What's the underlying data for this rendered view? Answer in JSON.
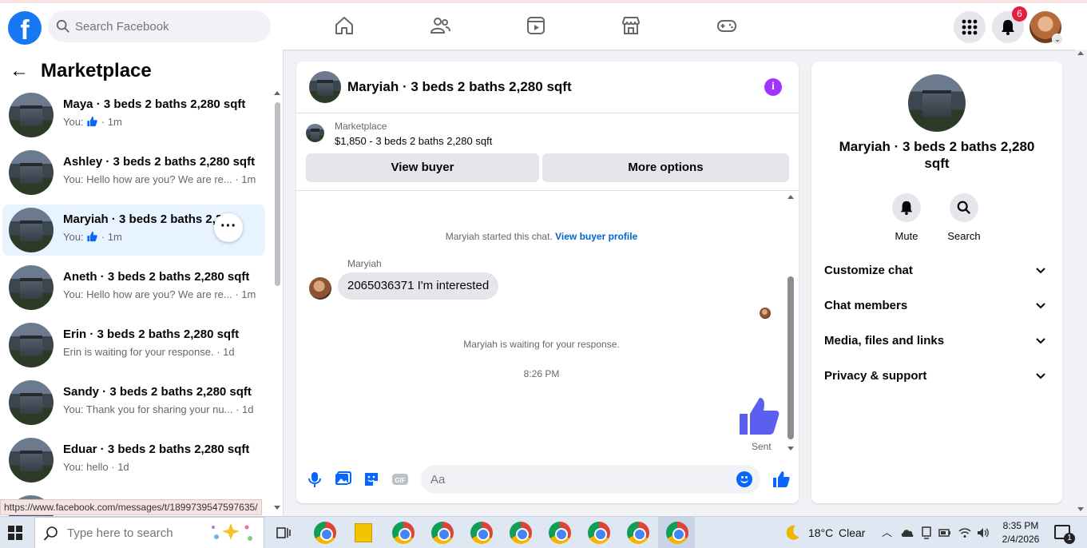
{
  "header": {
    "logo_letter": "f",
    "search_placeholder": "Search Facebook",
    "nav_icons": [
      "home-icon",
      "friends-icon",
      "watch-icon",
      "marketplace-icon",
      "gaming-icon"
    ],
    "notification_count": "6",
    "brand_color": "#1877f2"
  },
  "left_panel": {
    "title": "Marketplace",
    "conversations": [
      {
        "title": "Maya · 3 beds 2 baths 2,280 sqft",
        "prefix": "You:",
        "time": "· 1m",
        "has_like": true
      },
      {
        "title": "Ashley · 3 beds 2 baths 2,280 sqft",
        "snippet": "You: Hello how are you? We are re...",
        "time": "· 1m"
      },
      {
        "title": "Maryiah · 3 beds 2 baths 2,28...",
        "prefix": "You:",
        "time": "· 1m",
        "has_like": true,
        "active": true
      },
      {
        "title": "Aneth · 3 beds 2 baths 2,280 sqft",
        "snippet": "You: Hello how are you? We are re...",
        "time": "· 1m"
      },
      {
        "title": "Erin · 3 beds 2 baths 2,280 sqft",
        "snippet": "Erin is waiting for your response.",
        "time": "· 1d"
      },
      {
        "title": "Sandy · 3 beds 2 baths 2,280 sqft",
        "snippet": "You: Thank you for sharing your nu...",
        "time": "· 1d"
      },
      {
        "title": "Eduar · 3 beds 2 baths 2,280 sqft",
        "snippet": "You: hello",
        "time": "· 1d"
      }
    ],
    "status_url": "https://www.facebook.com/messages/t/1899739547597635/"
  },
  "chat": {
    "title": "Maryiah · 3 beds 2 baths 2,280 sqft",
    "listing_source": "Marketplace",
    "listing_detail": "$1,850 - 3 beds 2 baths 2,280 sqft",
    "view_buyer_label": "View buyer",
    "more_options_label": "More options",
    "started_text": "Maryiah started this chat.",
    "view_profile_link": "View buyer profile",
    "sender_name": "Maryiah",
    "message": "2065036371 I'm interested",
    "waiting_text": "Maryiah is waiting for your response.",
    "timestamp": "8:26 PM",
    "sent_label": "Sent",
    "composer_placeholder": "Aa",
    "accent_color": "#0866ff"
  },
  "info_panel": {
    "name": "Maryiah · 3 beds 2 baths 2,280 sqft",
    "mute_label": "Mute",
    "search_label": "Search",
    "sections": [
      "Customize chat",
      "Chat members",
      "Media, files and links",
      "Privacy & support"
    ]
  },
  "taskbar": {
    "search_placeholder": "Type here to search",
    "weather_temp": "18°C",
    "weather_text": "Clear",
    "time": "8:35 PM",
    "date": "2/4/2026",
    "notification_count": "1"
  }
}
